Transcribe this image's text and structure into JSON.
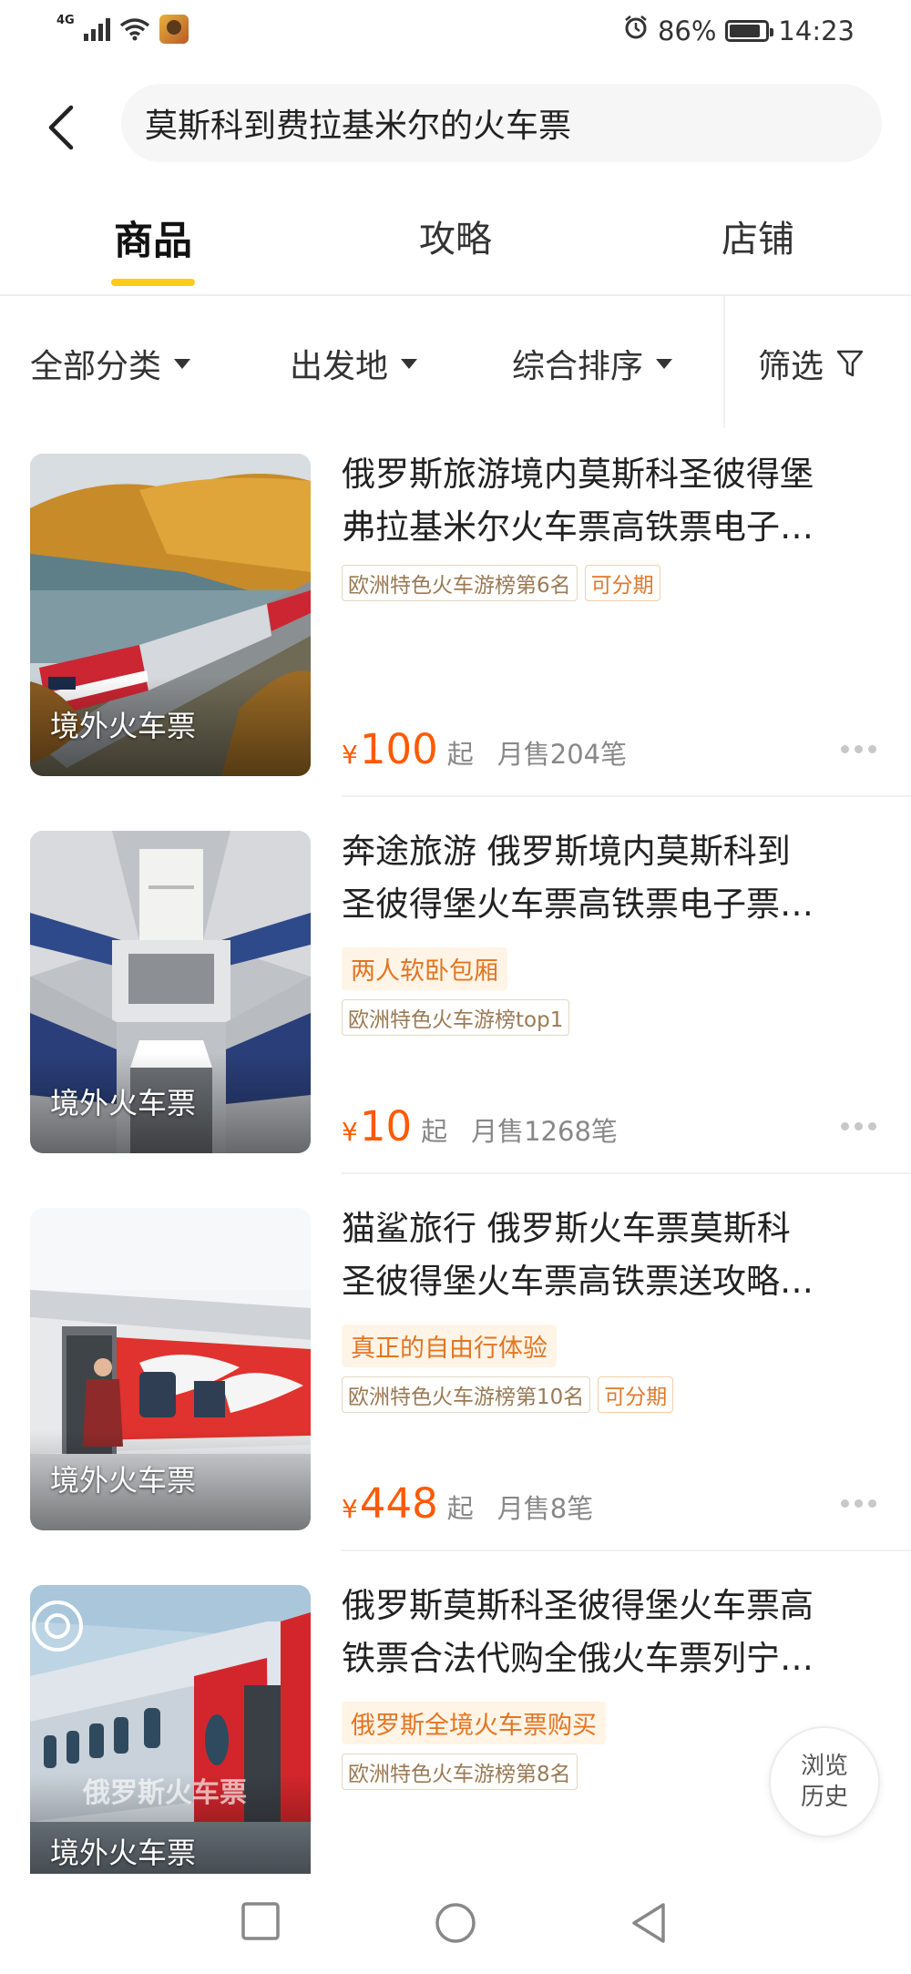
{
  "status_bar": {
    "network": "4G",
    "battery": "86%",
    "battery_level": 0.86,
    "time": "14:23"
  },
  "header": {
    "search_query": "莫斯科到费拉基米尔的火车票"
  },
  "tabs": [
    {
      "label": "商品",
      "active": true
    },
    {
      "label": "攻略",
      "active": false
    },
    {
      "label": "店铺",
      "active": false
    }
  ],
  "filters": {
    "category": "全部分类",
    "origin": "出发地",
    "sort": "综合排序",
    "filter": "筛选"
  },
  "products": [
    {
      "thumb_label": "境外火车票",
      "title_line1": "俄罗斯旅游境内莫斯科圣彼得堡",
      "title_line2": "弗拉基米尔火车票高铁票电子…",
      "tags": [
        "欧洲特色火车游榜第6名",
        "可分期"
      ],
      "currency": "¥",
      "price": "100",
      "price_suffix": "起",
      "sales": "月售204笔"
    },
    {
      "thumb_label": "境外火车票",
      "title_line1": "奔途旅游 俄罗斯境内莫斯科到",
      "title_line2": "圣彼得堡火车票高铁票电子票…",
      "highlight": "两人软卧包厢",
      "tags": [
        "欧洲特色火车游榜top1"
      ],
      "currency": "¥",
      "price": "10",
      "price_suffix": "起",
      "sales": "月售1268笔"
    },
    {
      "thumb_label": "境外火车票",
      "title_line1": "猫鲨旅行 俄罗斯火车票莫斯科",
      "title_line2": "圣彼得堡火车票高铁票送攻略…",
      "highlight": "真正的自由行体验",
      "tags": [
        "欧洲特色火车游榜第10名",
        "可分期"
      ],
      "currency": "¥",
      "price": "448",
      "price_suffix": "起",
      "sales": "月售8笔"
    },
    {
      "thumb_label": "境外火车票",
      "thumb_watermark": "俄罗斯火车票",
      "title_line1": "俄罗斯莫斯科圣彼得堡火车票高",
      "title_line2": "铁票合法代购全俄火车票列宁…",
      "highlight": "俄罗斯全境火车票购买",
      "tags": [
        "欧洲特色火车游榜第8名"
      ]
    }
  ],
  "history_button": {
    "line1": "浏览",
    "line2": "历史"
  },
  "colors": {
    "accent_yellow": "#ffcb1a",
    "price_orange": "#ff5a00",
    "tag_orange": "#e27522"
  }
}
